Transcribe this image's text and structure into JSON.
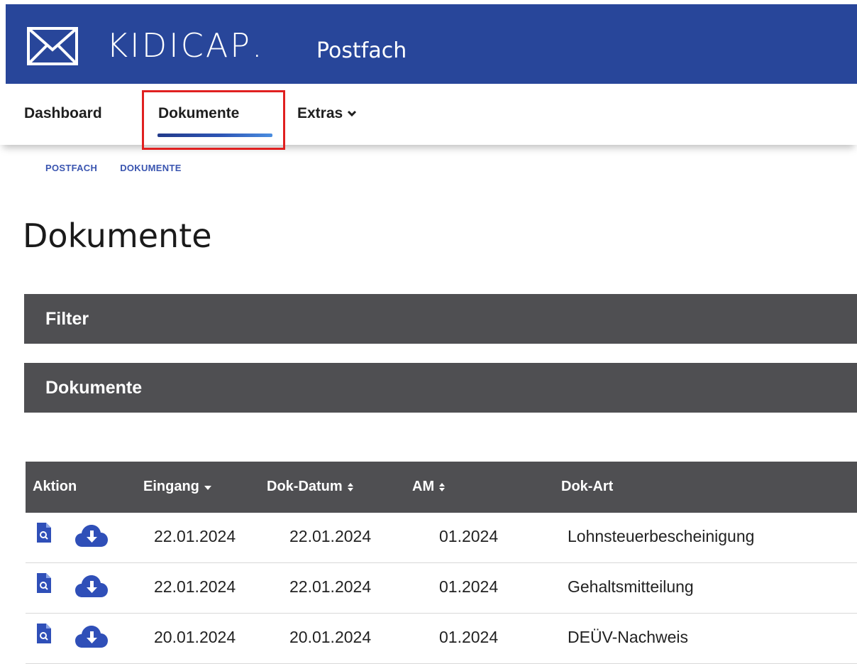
{
  "header": {
    "brand": "KIDICAP",
    "brand_dot": ".",
    "product": "Postfach"
  },
  "nav": {
    "dashboard": "Dashboard",
    "dokumente": "Dokumente",
    "extras": "Extras"
  },
  "breadcrumb": [
    "POSTFACH",
    "DOKUMENTE"
  ],
  "page_title": "Dokumente",
  "panels": {
    "filter": "Filter",
    "documents": "Dokumente"
  },
  "table": {
    "headers": {
      "aktion": "Aktion",
      "eingang": "Eingang",
      "dokdatum": "Dok-Datum",
      "am": "AM",
      "dokart": "Dok-Art"
    },
    "rows": [
      {
        "eingang": "22.01.2024",
        "dokdatum": "22.01.2024",
        "am": "01.2024",
        "dokart": "Lohnsteuerbescheinigung"
      },
      {
        "eingang": "22.01.2024",
        "dokdatum": "22.01.2024",
        "am": "01.2024",
        "dokart": "Gehaltsmitteilung"
      },
      {
        "eingang": "20.01.2024",
        "dokdatum": "20.01.2024",
        "am": "01.2024",
        "dokart": "DEÜV-Nachweis"
      }
    ]
  },
  "colors": {
    "header_bg": "#28469a",
    "panel_bg": "#4f4f52",
    "accent_blue": "#2f4fb8",
    "highlight": "#e02020"
  },
  "icons": {
    "logo": "envelope-icon",
    "extras_dropdown": "chevron-down-icon",
    "sort_eingang": "sort-desc-icon",
    "sort_other": "sort-icon",
    "row_view": "document-search-icon",
    "row_download": "cloud-download-icon"
  }
}
